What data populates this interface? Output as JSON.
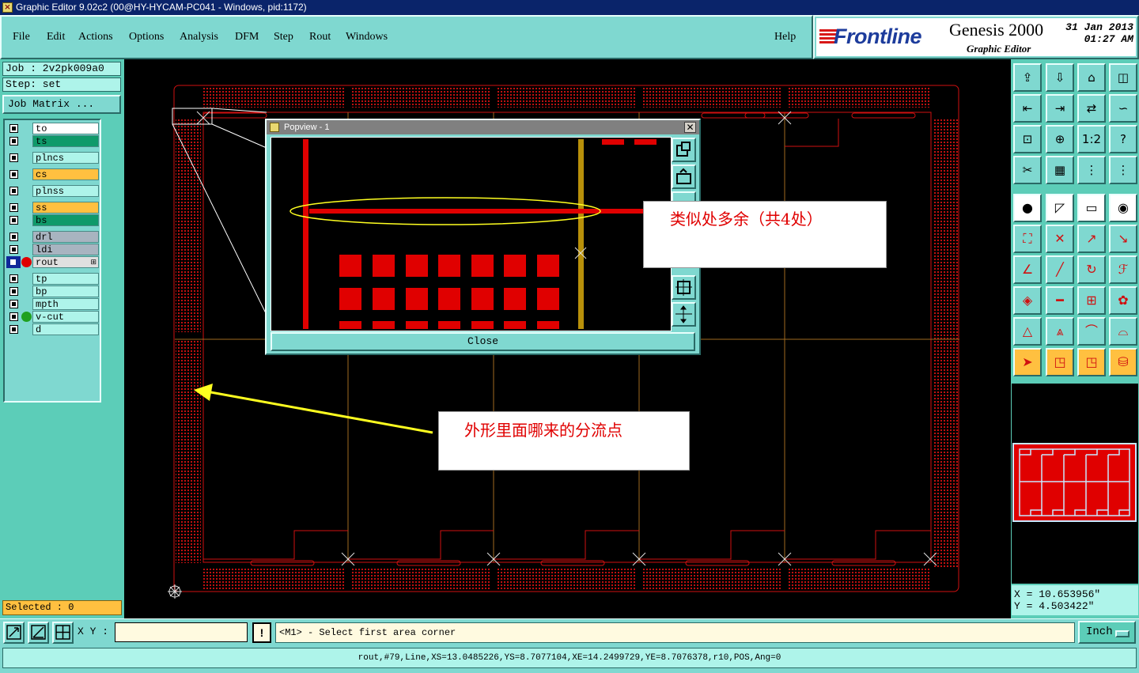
{
  "window": {
    "title": "Graphic Editor 9.02c2 (00@HY-HYCAM-PC041 - Windows, pid:1172)"
  },
  "menu": {
    "items": [
      "File",
      "Edit",
      "Actions",
      "Options",
      "Analysis",
      "DFM",
      "Step",
      "Rout",
      "Windows"
    ],
    "help": "Help"
  },
  "brand": {
    "logo": "Frontline",
    "product": "Genesis 2000",
    "subtitle": "Graphic Editor",
    "date": "31 Jan 2013",
    "time": "01:27 AM"
  },
  "job": {
    "job_label": "Job : 2v2pk009a0",
    "step_label": "Step: set",
    "matrix_button": "Job Matrix ..."
  },
  "layers": [
    {
      "name": "to",
      "color": "#ffffff",
      "checked": true
    },
    {
      "name": "ts",
      "color": "#0f9a6a",
      "checked": true
    },
    {
      "name": "plncs",
      "color": "#aef4ea",
      "checked": true
    },
    {
      "name": "cs",
      "color": "#ffc040",
      "checked": true
    },
    {
      "name": "plnss",
      "color": "#aef4ea",
      "checked": true
    },
    {
      "name": "ss",
      "color": "#ffc040",
      "checked": true
    },
    {
      "name": "bs",
      "color": "#0f9a6a",
      "checked": true
    },
    {
      "name": "drl",
      "color": "#a8b4c0",
      "checked": true
    },
    {
      "name": "ldi",
      "color": "#a8b4c0",
      "checked": true
    },
    {
      "name": "rout",
      "color": "#e0e0e0",
      "checked": true,
      "selected": true,
      "display_color": "#e00000"
    },
    {
      "name": "tp",
      "color": "#aef4ea",
      "checked": true
    },
    {
      "name": "bp",
      "color": "#aef4ea",
      "checked": true
    },
    {
      "name": "mpth",
      "color": "#aef4ea",
      "checked": true
    },
    {
      "name": "v-cut",
      "color": "#aef4ea",
      "checked": true,
      "display_color": "#20a020"
    },
    {
      "name": "d",
      "color": "#aef4ea",
      "checked": true
    }
  ],
  "selection": {
    "label": "Selected : 0"
  },
  "popview": {
    "title": "Popview - 1",
    "close_label": "Close"
  },
  "annotations": {
    "note1": "类似处多余（共4处）",
    "note2": "外形里面哪来的分流点"
  },
  "coords": {
    "x_label": "X = 10.653956\"",
    "y_label": "Y = 4.503422\""
  },
  "command": {
    "xy_label": "X Y :",
    "xy_value": "",
    "warn_symbol": "!",
    "prompt": "<M1> - Select first area corner",
    "unit": "Inch"
  },
  "status": {
    "text": "rout,#79,Line,XS=13.0485226,YS=8.7077104,XE=14.2499729,YE=8.7076378,r10,POS,Ang=0"
  },
  "colors": {
    "accent": "#7fd8d0",
    "canvas": "#000000",
    "rout": "#e00000",
    "annotation": "#e00000",
    "arrow": "#ffff20",
    "highlight": "#ffff20"
  }
}
